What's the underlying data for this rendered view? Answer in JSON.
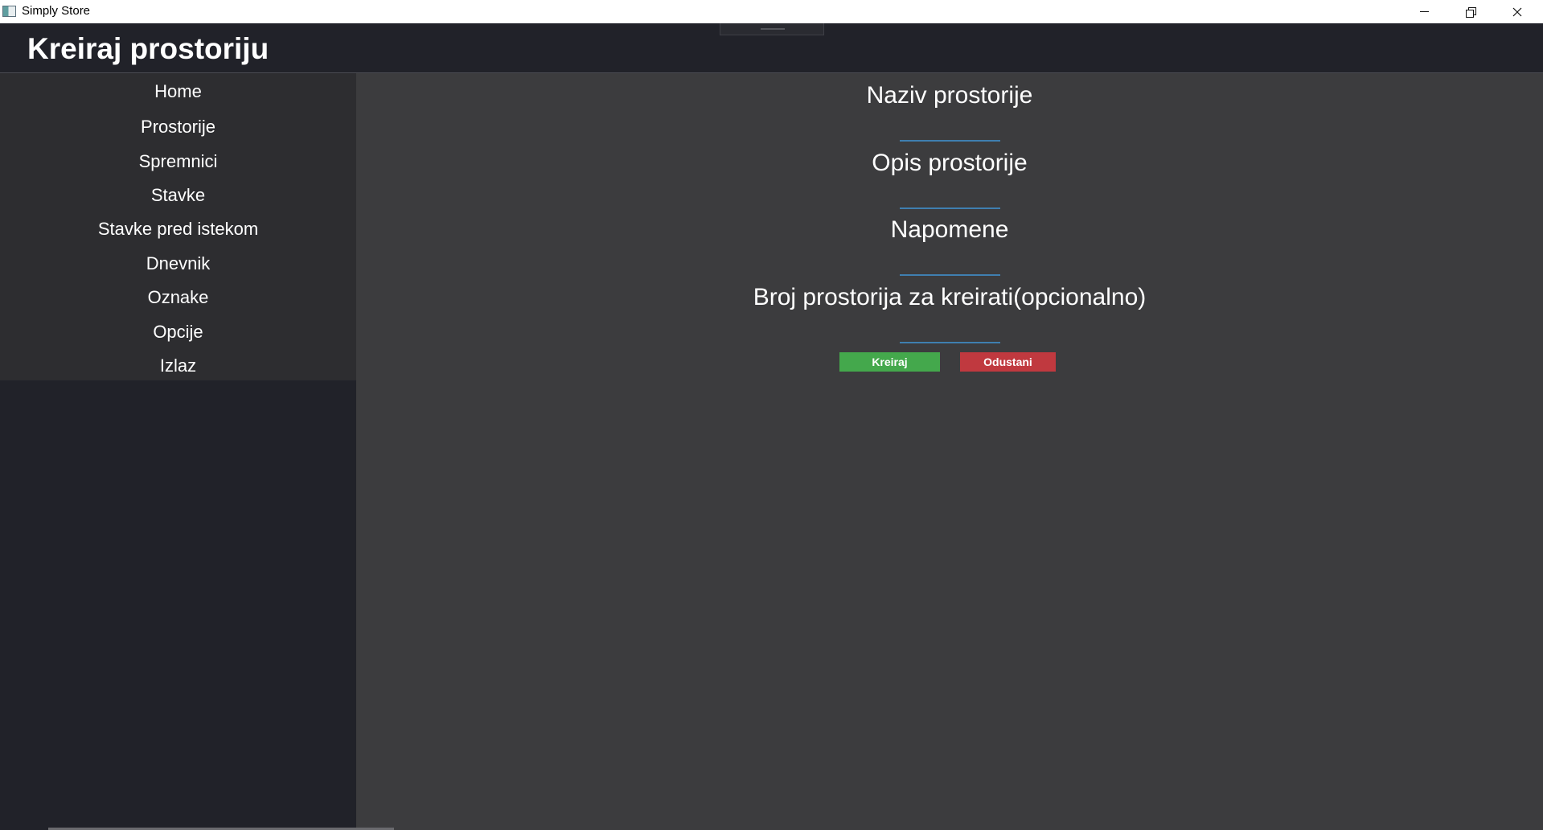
{
  "window": {
    "title": "Simply Store",
    "icons": {
      "app": "app-icon",
      "minimize": "minimize-icon",
      "maximize": "restore-icon",
      "close": "close-icon"
    }
  },
  "header": {
    "title": "Kreiraj prostoriju"
  },
  "sidebar": {
    "items": [
      {
        "label": "Home"
      },
      {
        "label": "Prostorije"
      },
      {
        "label": "Spremnici"
      },
      {
        "label": "Stavke"
      },
      {
        "label": "Stavke pred istekom"
      },
      {
        "label": "Dnevnik"
      },
      {
        "label": "Oznake"
      },
      {
        "label": "Opcije"
      },
      {
        "label": "Izlaz"
      }
    ]
  },
  "form": {
    "fields": [
      {
        "label": "Naziv prostorije",
        "value": ""
      },
      {
        "label": "Opis prostorije",
        "value": ""
      },
      {
        "label": "Napomene",
        "value": ""
      },
      {
        "label": "Broj prostorija za kreirati(opcionalno)",
        "value": ""
      }
    ],
    "buttons": {
      "create": "Kreiraj",
      "cancel": "Odustani"
    }
  },
  "colors": {
    "header_bg": "#212229",
    "sidebar_nav_bg": "#2d2d30",
    "main_bg": "#3c3c3e",
    "input_underline": "#3f7fb0",
    "create_button": "#44a84c",
    "cancel_button": "#c0393f"
  }
}
